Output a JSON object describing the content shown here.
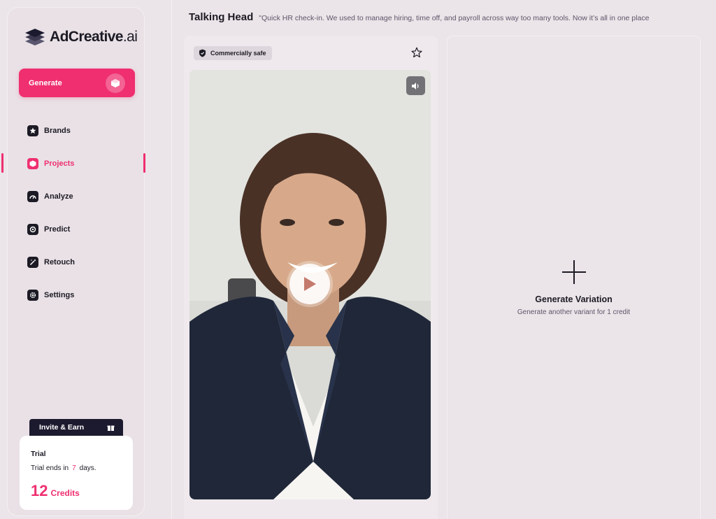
{
  "brand": {
    "name_main": "AdCreative",
    "name_suffix": ".ai"
  },
  "sidebar": {
    "generate_label": "Generate",
    "items": [
      {
        "label": "Brands",
        "icon": "star-icon"
      },
      {
        "label": "Projects",
        "icon": "cube-icon",
        "active": true
      },
      {
        "label": "Analyze",
        "icon": "gauge-icon"
      },
      {
        "label": "Predict",
        "icon": "predict-icon"
      },
      {
        "label": "Retouch",
        "icon": "wand-icon"
      },
      {
        "label": "Settings",
        "icon": "gear-icon"
      }
    ],
    "invite_label": "Invite & Earn",
    "trial": {
      "title": "Trial",
      "text_before": "Trial ends in",
      "days": "7",
      "text_after": "days.",
      "credits_count": "12",
      "credits_label": "Credits"
    }
  },
  "header": {
    "title": "Talking Head",
    "quote": "\"Quick HR check-in. We used to manage hiring, time off, and payroll across way too many tools. Now it’s all in one place"
  },
  "card": {
    "badge": "Commercially safe"
  },
  "variation": {
    "title": "Generate Variation",
    "subtitle": "Generate another variant for 1 credit"
  },
  "colors": {
    "accent": "#ef2f6f",
    "dark": "#1c1a24"
  }
}
